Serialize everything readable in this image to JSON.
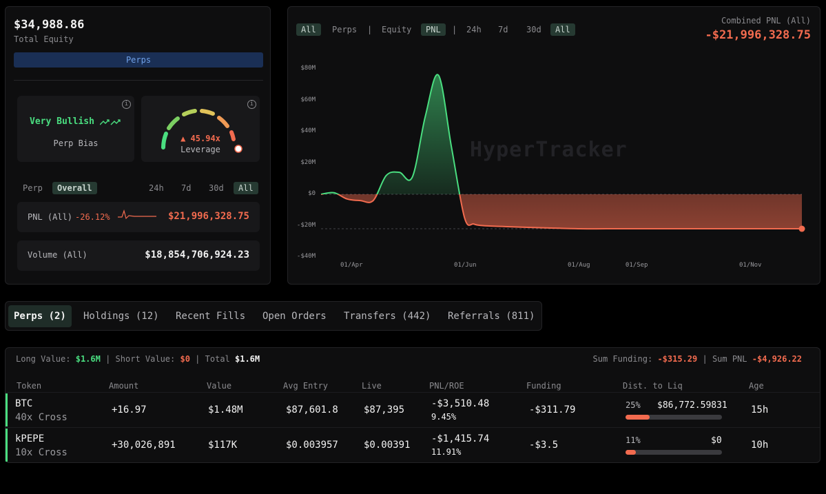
{
  "equity": {
    "value": "$34,988.86",
    "label": "Total Equity",
    "tab": "Perps"
  },
  "bias": {
    "value": "Very Bullish",
    "label": "Perp Bias"
  },
  "leverage": {
    "value": "45.94x",
    "label": "Leverage"
  },
  "metrics_tabs": {
    "items": [
      "Perp",
      "Overall"
    ],
    "active": "Overall",
    "periods": [
      "24h",
      "7d",
      "30d",
      "All"
    ],
    "active_period": "All"
  },
  "pnl_card": {
    "label": "PNL (All)",
    "pct": "-26.12%",
    "value": "$21,996,328.75"
  },
  "volume_card": {
    "label": "Volume (All)",
    "value": "$18,854,706,924.23"
  },
  "chart_controls": {
    "filters": [
      "All",
      "Perps",
      "|",
      "Equity",
      "PNL",
      "|",
      "24h",
      "7d",
      "30d",
      "All"
    ],
    "combined_label": "Combined PNL (All)",
    "combined_value": "-$21,996,328.75"
  },
  "watermark": {
    "title": "HyperTracker"
  },
  "chart_data": {
    "type": "area",
    "x": [
      "03-15",
      "03-22",
      "03-29",
      "04-05",
      "04-12",
      "04-19",
      "04-26",
      "05-03",
      "05-10",
      "05-17",
      "05-24",
      "05-31",
      "06-05",
      "06-10",
      "06-20",
      "07-01",
      "07-15",
      "08-01",
      "08-15",
      "09-01",
      "09-15",
      "10-01",
      "10-15",
      "11-01",
      "11-15",
      "11-28"
    ],
    "values": [
      0,
      1,
      -3,
      -4,
      -4,
      12,
      14,
      11,
      50,
      76,
      30,
      -15,
      -19,
      -20,
      -20.5,
      -21,
      -21.5,
      -22,
      -22,
      -22,
      -22,
      -22,
      -22,
      -22,
      -22,
      -22
    ],
    "ylim": [
      -40,
      80
    ],
    "yticks": [
      "$80M",
      "$60M",
      "$40M",
      "$20M",
      "$0",
      "-$20M",
      "-$40M"
    ],
    "xticks": [
      "01/Apr",
      "01/Jun",
      "01/Aug",
      "01/Sep",
      "01/Nov"
    ],
    "grid": false,
    "positive_color": "#4ade80",
    "negative_color": "#f26b4f"
  },
  "tabs": [
    "Perps (2)",
    "Holdings (12)",
    "Recent Fills",
    "Open Orders",
    "Transfers (442)",
    "Referrals (811)"
  ],
  "summary": {
    "long_label": "Long Value:",
    "long_value": "$1.6M",
    "short_label": "Short Value:",
    "short_value": "$0",
    "total_label": "Total",
    "total_value": "$1.6M",
    "funding_label": "Sum Funding:",
    "funding_value": "-$315.29",
    "sum_pnl_label": "Sum PNL",
    "sum_pnl_value": "-$4,926.22"
  },
  "table": {
    "headers": [
      "Token",
      "Amount",
      "Value",
      "Avg Entry",
      "Live",
      "PNL/ROE",
      "Funding",
      "Dist. to Liq",
      "Age"
    ],
    "rows": [
      {
        "token": "BTC",
        "sub": "40x Cross",
        "amount": "+16.97",
        "value": "$1.48M",
        "entry": "$87,601.8",
        "live": "$87,395",
        "pnl": "-$3,510.48",
        "roe": "9.45%",
        "funding": "-$311.79",
        "liq_pct": "25%",
        "liq_price": "$86,772.59831",
        "liq_fill": 0.25,
        "age": "15h"
      },
      {
        "token": "kPEPE",
        "sub": "10x Cross",
        "amount": "+30,026,891",
        "value": "$117K",
        "entry": "$0.003957",
        "live": "$0.00391",
        "pnl": "-$1,415.74",
        "roe": "11.91%",
        "funding": "-$3.5",
        "liq_pct": "11%",
        "liq_price": "$0",
        "liq_fill": 0.11,
        "age": "10h"
      }
    ]
  }
}
